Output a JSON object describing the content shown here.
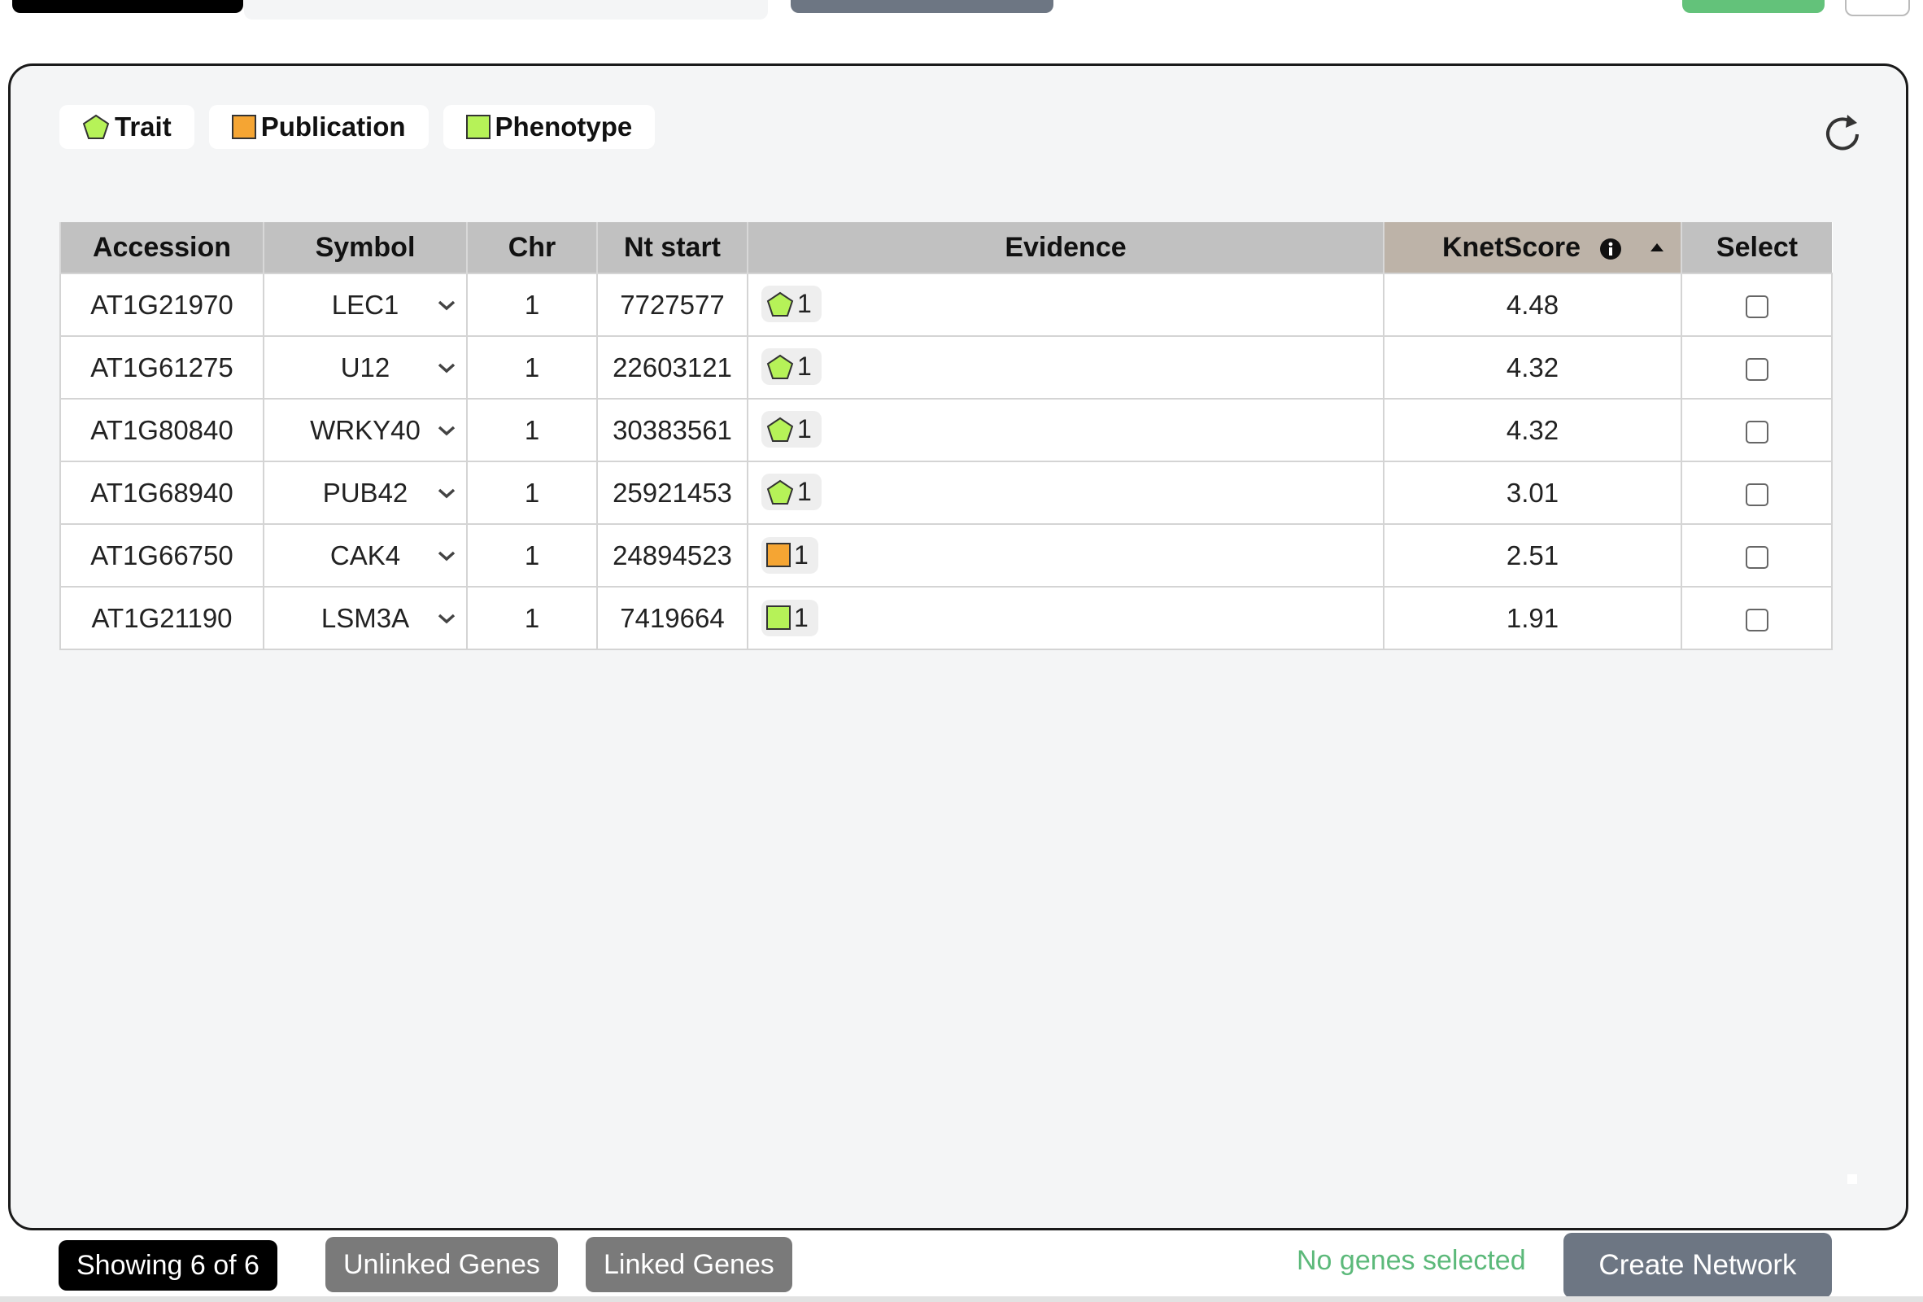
{
  "legend": [
    {
      "label": "Trait",
      "icon": "pentagon-icon",
      "color": "#b6f258"
    },
    {
      "label": "Publication",
      "icon": "orange-square-icon",
      "color": "#f5a533"
    },
    {
      "label": "Phenotype",
      "icon": "lime-square-icon",
      "color": "#b6f258"
    }
  ],
  "table": {
    "headers": {
      "accession": "Accession",
      "symbol": "Symbol",
      "chr": "Chr",
      "nt_start": "Nt start",
      "evidence": "Evidence",
      "knetscore": "KnetScore",
      "select": "Select"
    },
    "rows": [
      {
        "accession": "AT1G21970",
        "symbol": "LEC1",
        "chr": "1",
        "nt_start": "7727577",
        "evidence_type": "trait",
        "evidence_count": "1",
        "knetscore": "4.48"
      },
      {
        "accession": "AT1G61275",
        "symbol": "U12",
        "chr": "1",
        "nt_start": "22603121",
        "evidence_type": "trait",
        "evidence_count": "1",
        "knetscore": "4.32"
      },
      {
        "accession": "AT1G80840",
        "symbol": "WRKY40",
        "chr": "1",
        "nt_start": "30383561",
        "evidence_type": "trait",
        "evidence_count": "1",
        "knetscore": "4.32"
      },
      {
        "accession": "AT1G68940",
        "symbol": "PUB42",
        "chr": "1",
        "nt_start": "25921453",
        "evidence_type": "trait",
        "evidence_count": "1",
        "knetscore": "3.01"
      },
      {
        "accession": "AT1G66750",
        "symbol": "CAK4",
        "chr": "1",
        "nt_start": "24894523",
        "evidence_type": "publication",
        "evidence_count": "1",
        "knetscore": "2.51"
      },
      {
        "accession": "AT1G21190",
        "symbol": "LSM3A",
        "chr": "1",
        "nt_start": "7419664",
        "evidence_type": "phenotype",
        "evidence_count": "1",
        "knetscore": "1.91"
      }
    ]
  },
  "footer": {
    "showing": "Showing 6 of 6",
    "unlinked": "Unlinked Genes",
    "linked": "Linked Genes",
    "status": "No genes selected",
    "create": "Create Network"
  },
  "colors": {
    "accent_green": "#5cb97a",
    "trait": "#b6f258",
    "publication": "#f5a533",
    "phenotype": "#b6f258",
    "create_button": "#6d7683"
  }
}
